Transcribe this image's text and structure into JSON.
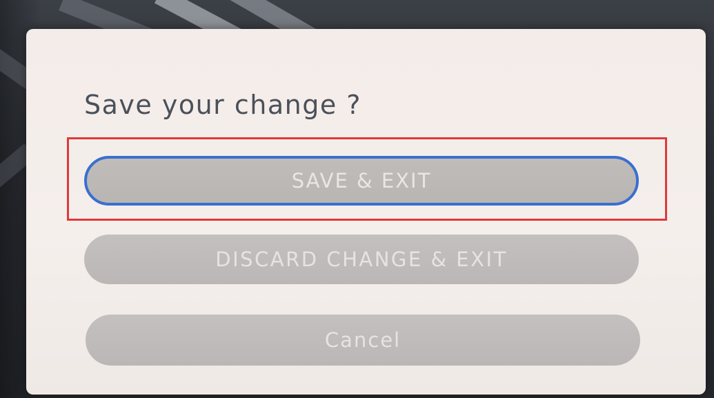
{
  "dialog": {
    "title": "Save your change ?",
    "buttons": {
      "save_exit": "SAVE & EXIT",
      "discard_exit": "DISCARD CHANGE & EXIT",
      "cancel": "Cancel"
    }
  },
  "colors": {
    "focus_ring": "#3a6fd0",
    "highlight_box": "#e0393a",
    "button_fill": "#bfbbba",
    "dialog_bg": "#f3ece9",
    "title_text": "#4b5059"
  }
}
